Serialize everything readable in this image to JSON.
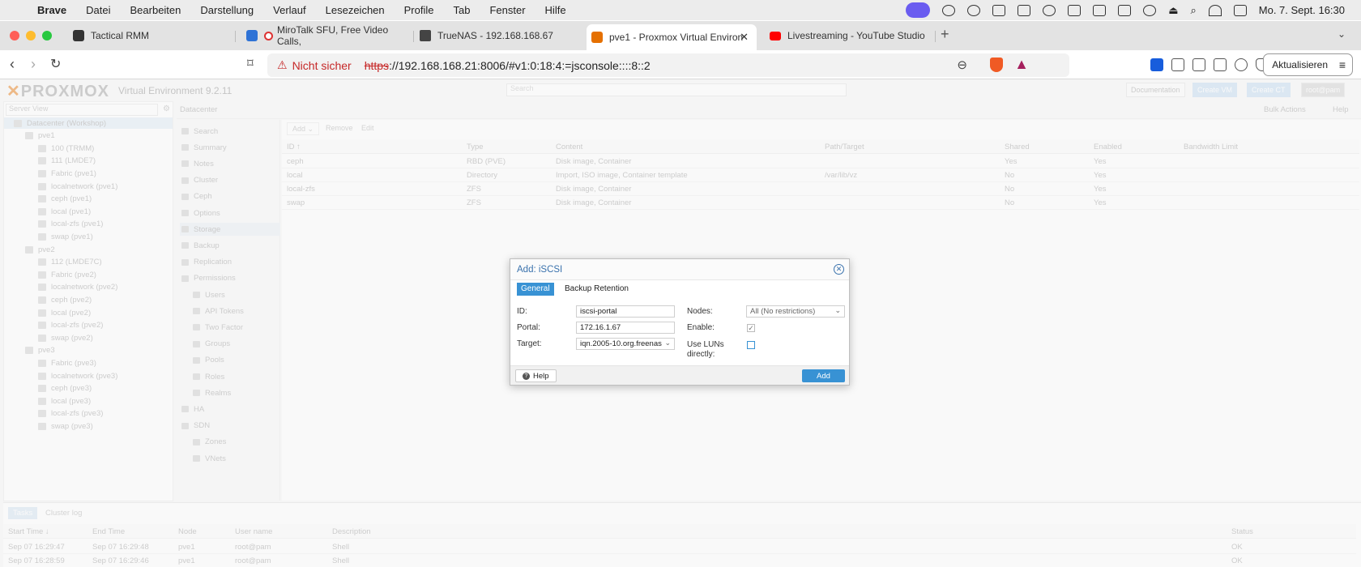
{
  "menubar": {
    "app": "Brave",
    "items": [
      "Datei",
      "Bearbeiten",
      "Darstellung",
      "Verlauf",
      "Lesezeichen",
      "Profile",
      "Tab",
      "Fenster",
      "Hilfe"
    ],
    "datetime": "Mo. 7. Sept.  16:30"
  },
  "tabs": [
    {
      "title": "Tactical RMM",
      "active": false
    },
    {
      "title": "MiroTalk SFU, Free Video Calls,",
      "active": false
    },
    {
      "title": "TrueNAS - 192.168.168.67",
      "active": false
    },
    {
      "title": "pve1 - Proxmox Virtual Environ",
      "active": true
    },
    {
      "title": "Livestreaming - YouTube Studio",
      "active": false
    }
  ],
  "addressbar": {
    "security": "Nicht sicher",
    "scheme": "https",
    "url_rest": "://192.168.168.21:8006/#v1:0:18:4:=jsconsole::::8::2",
    "update_label": "Aktualisieren"
  },
  "pve": {
    "logo": "PROXMOX",
    "version": "Virtual Environment 9.2.11",
    "search_placeholder": "Search",
    "header_buttons": [
      "Documentation",
      "Create VM",
      "Create CT",
      "root@pam"
    ],
    "view_select": "Server View",
    "tree": [
      {
        "label": "Datacenter (Workshop)",
        "level": 0,
        "selected": true
      },
      {
        "label": "pve1",
        "level": 1
      },
      {
        "label": "100 (TRMM)",
        "level": 2
      },
      {
        "label": "111 (LMDE7)",
        "level": 2
      },
      {
        "label": "Fabric (pve1)",
        "level": 2
      },
      {
        "label": "localnetwork (pve1)",
        "level": 2
      },
      {
        "label": "ceph (pve1)",
        "level": 2
      },
      {
        "label": "local (pve1)",
        "level": 2
      },
      {
        "label": "local-zfs (pve1)",
        "level": 2
      },
      {
        "label": "swap (pve1)",
        "level": 2
      },
      {
        "label": "pve2",
        "level": 1
      },
      {
        "label": "112 (LMDE7C)",
        "level": 2
      },
      {
        "label": "Fabric (pve2)",
        "level": 2
      },
      {
        "label": "localnetwork (pve2)",
        "level": 2
      },
      {
        "label": "ceph (pve2)",
        "level": 2
      },
      {
        "label": "local (pve2)",
        "level": 2
      },
      {
        "label": "local-zfs (pve2)",
        "level": 2
      },
      {
        "label": "swap (pve2)",
        "level": 2
      },
      {
        "label": "pve3",
        "level": 1
      },
      {
        "label": "Fabric (pve3)",
        "level": 2
      },
      {
        "label": "localnetwork (pve3)",
        "level": 2
      },
      {
        "label": "ceph (pve3)",
        "level": 2
      },
      {
        "label": "local (pve3)",
        "level": 2
      },
      {
        "label": "local-zfs (pve3)",
        "level": 2
      },
      {
        "label": "swap (pve3)",
        "level": 2
      }
    ],
    "breadcrumb": "Datacenter",
    "bulk_actions": "Bulk Actions",
    "help": "Help",
    "nav": [
      {
        "label": "Search",
        "sub": false
      },
      {
        "label": "Summary",
        "sub": false
      },
      {
        "label": "Notes",
        "sub": false
      },
      {
        "label": "Cluster",
        "sub": false
      },
      {
        "label": "Ceph",
        "sub": false
      },
      {
        "label": "Options",
        "sub": false
      },
      {
        "label": "Storage",
        "sub": false,
        "selected": true
      },
      {
        "label": "Backup",
        "sub": false
      },
      {
        "label": "Replication",
        "sub": false
      },
      {
        "label": "Permissions",
        "sub": false
      },
      {
        "label": "Users",
        "sub": true
      },
      {
        "label": "API Tokens",
        "sub": true
      },
      {
        "label": "Two Factor",
        "sub": true
      },
      {
        "label": "Groups",
        "sub": true
      },
      {
        "label": "Pools",
        "sub": true
      },
      {
        "label": "Roles",
        "sub": true
      },
      {
        "label": "Realms",
        "sub": true
      },
      {
        "label": "HA",
        "sub": false
      },
      {
        "label": "SDN",
        "sub": false
      },
      {
        "label": "Zones",
        "sub": true
      },
      {
        "label": "VNets",
        "sub": true
      }
    ],
    "toolbar": [
      "Add",
      "Remove",
      "Edit"
    ],
    "columns": [
      "ID ↑",
      "Type",
      "Content",
      "Path/Target",
      "Shared",
      "Enabled",
      "Bandwidth Limit"
    ],
    "rows": [
      [
        "ceph",
        "RBD (PVE)",
        "Disk image, Container",
        "",
        "Yes",
        "Yes",
        ""
      ],
      [
        "local",
        "Directory",
        "Import, ISO image, Container template",
        "/var/lib/vz",
        "No",
        "Yes",
        ""
      ],
      [
        "local-zfs",
        "ZFS",
        "Disk image, Container",
        "",
        "No",
        "Yes",
        ""
      ],
      [
        "swap",
        "ZFS",
        "Disk image, Container",
        "",
        "No",
        "Yes",
        ""
      ]
    ],
    "log_tabs": [
      "Tasks",
      "Cluster log"
    ],
    "log_columns": [
      "Start Time ↓",
      "End Time",
      "Node",
      "User name",
      "Description",
      "Status"
    ],
    "log_rows": [
      [
        "Sep 07 16:29:47",
        "Sep 07 16:29:48",
        "pve1",
        "root@pam",
        "Shell",
        "OK"
      ],
      [
        "Sep 07 16:28:59",
        "Sep 07 16:29:46",
        "pve1",
        "root@pam",
        "Shell",
        "OK"
      ]
    ]
  },
  "dialog": {
    "title": "Add: iSCSI",
    "tabs": [
      "General",
      "Backup Retention"
    ],
    "id_label": "ID:",
    "id_value": "iscsi-portal",
    "portal_label": "Portal:",
    "portal_value": "172.16.1.67",
    "target_label": "Target:",
    "target_value": "iqn.2005-10.org.freenas",
    "nodes_label": "Nodes:",
    "nodes_value": "All (No restrictions)",
    "enable_label": "Enable:",
    "enable_checked": true,
    "luns_label_1": "Use LUNs",
    "luns_label_2": "directly:",
    "luns_checked": false,
    "help_label": "Help",
    "add_label": "Add"
  }
}
